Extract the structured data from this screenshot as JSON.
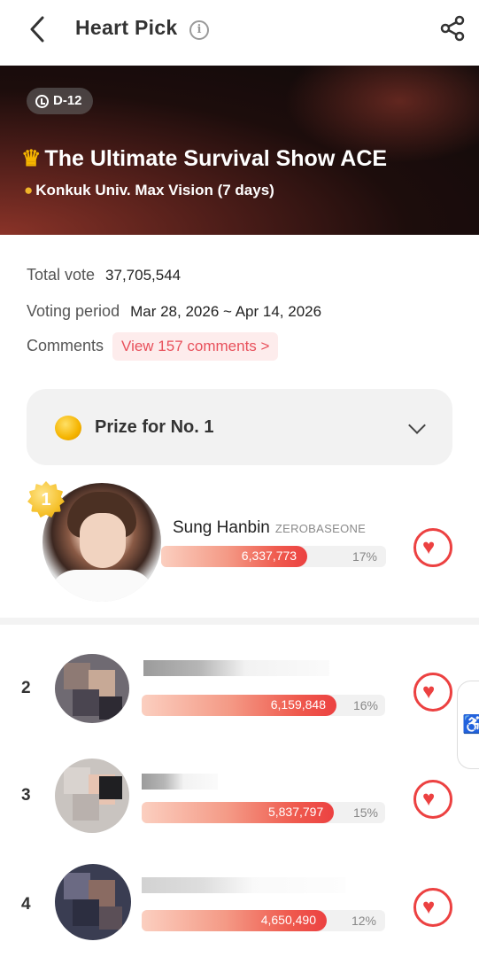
{
  "header": {
    "title": "Heart Pick",
    "info_icon": "info-icon",
    "back_icon": "chevron-left-icon",
    "share_icon": "share-icon"
  },
  "banner": {
    "dday": "D-12",
    "title": "The Ultimate Survival Show ACE",
    "subtitle": "Konkuk Univ. Max Vision (7 days)"
  },
  "info": {
    "total_vote_label": "Total vote",
    "total_vote_value": "37,705,544",
    "voting_period_label": "Voting period",
    "voting_period_value": "Mar 28, 2026 ~ Apr 14, 2026",
    "comments_label": "Comments",
    "comments_button": "View 157 comments >"
  },
  "prize": {
    "label": "Prize for No. 1"
  },
  "ranking": [
    {
      "rank": "1",
      "name": "Sung Hanbin",
      "group": "ZEROBASEONE",
      "votes": "6,337,773",
      "percent": "17%",
      "fill": 0.65
    },
    {
      "rank": "2",
      "name": "",
      "group": "",
      "votes": "6,159,848",
      "percent": "16%",
      "fill": 0.8
    },
    {
      "rank": "3",
      "name": "",
      "group": "",
      "votes": "5,837,797",
      "percent": "15%",
      "fill": 0.79
    },
    {
      "rank": "4",
      "name": "",
      "group": "",
      "votes": "4,650,490",
      "percent": "12%",
      "fill": 0.76
    }
  ],
  "colors": {
    "accent": "#ec4141",
    "comments_bg": "#fdecec",
    "prize_bg": "#f2f2f2"
  }
}
